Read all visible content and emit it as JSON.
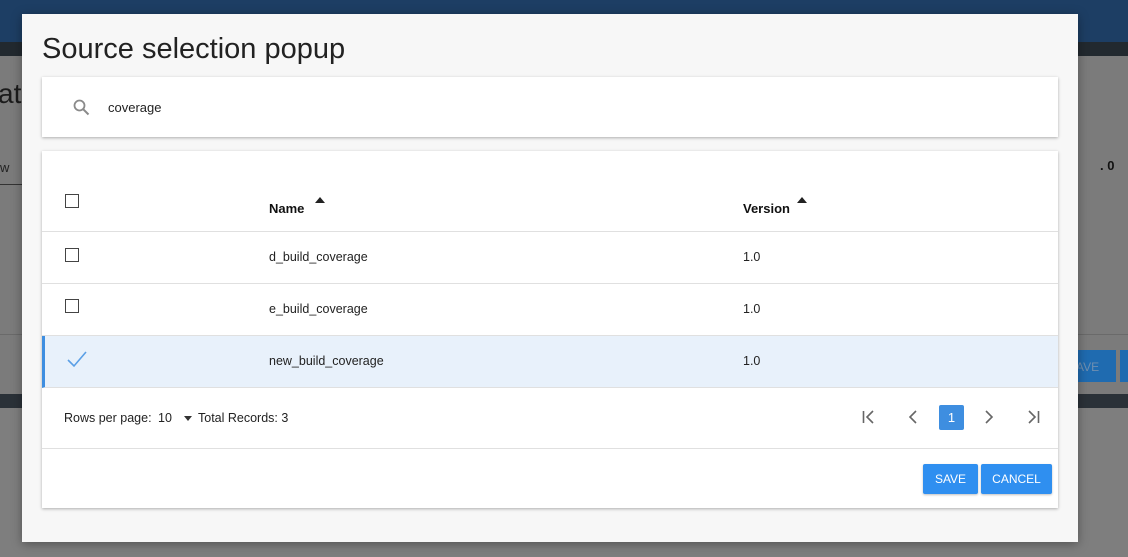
{
  "background": {
    "heading_fragment": "at",
    "field_fragment": "w",
    "right_value": ". 0",
    "save_fragment": "AVE"
  },
  "modal": {
    "title": "Source selection popup",
    "search": {
      "icon": "search-icon",
      "value": "coverage"
    },
    "table": {
      "columns": [
        {
          "label": "Name",
          "sort": "asc"
        },
        {
          "label": "Version",
          "sort": "asc"
        }
      ],
      "rows": [
        {
          "name": "d_build_coverage",
          "version": "1.0",
          "selected": false
        },
        {
          "name": "e_build_coverage",
          "version": "1.0",
          "selected": false
        },
        {
          "name": "new_build_coverage",
          "version": "1.0",
          "selected": true
        }
      ]
    },
    "pagination": {
      "rows_per_page_label": "Rows per page:",
      "rows_per_page_value": "10",
      "total_records_label": "Total Records: 3",
      "current_page": "1"
    },
    "buttons": {
      "save": "SAVE",
      "cancel": "CANCEL"
    },
    "colors": {
      "accent": "#2f8ff0",
      "selected_row": "#e8f1fb"
    }
  }
}
